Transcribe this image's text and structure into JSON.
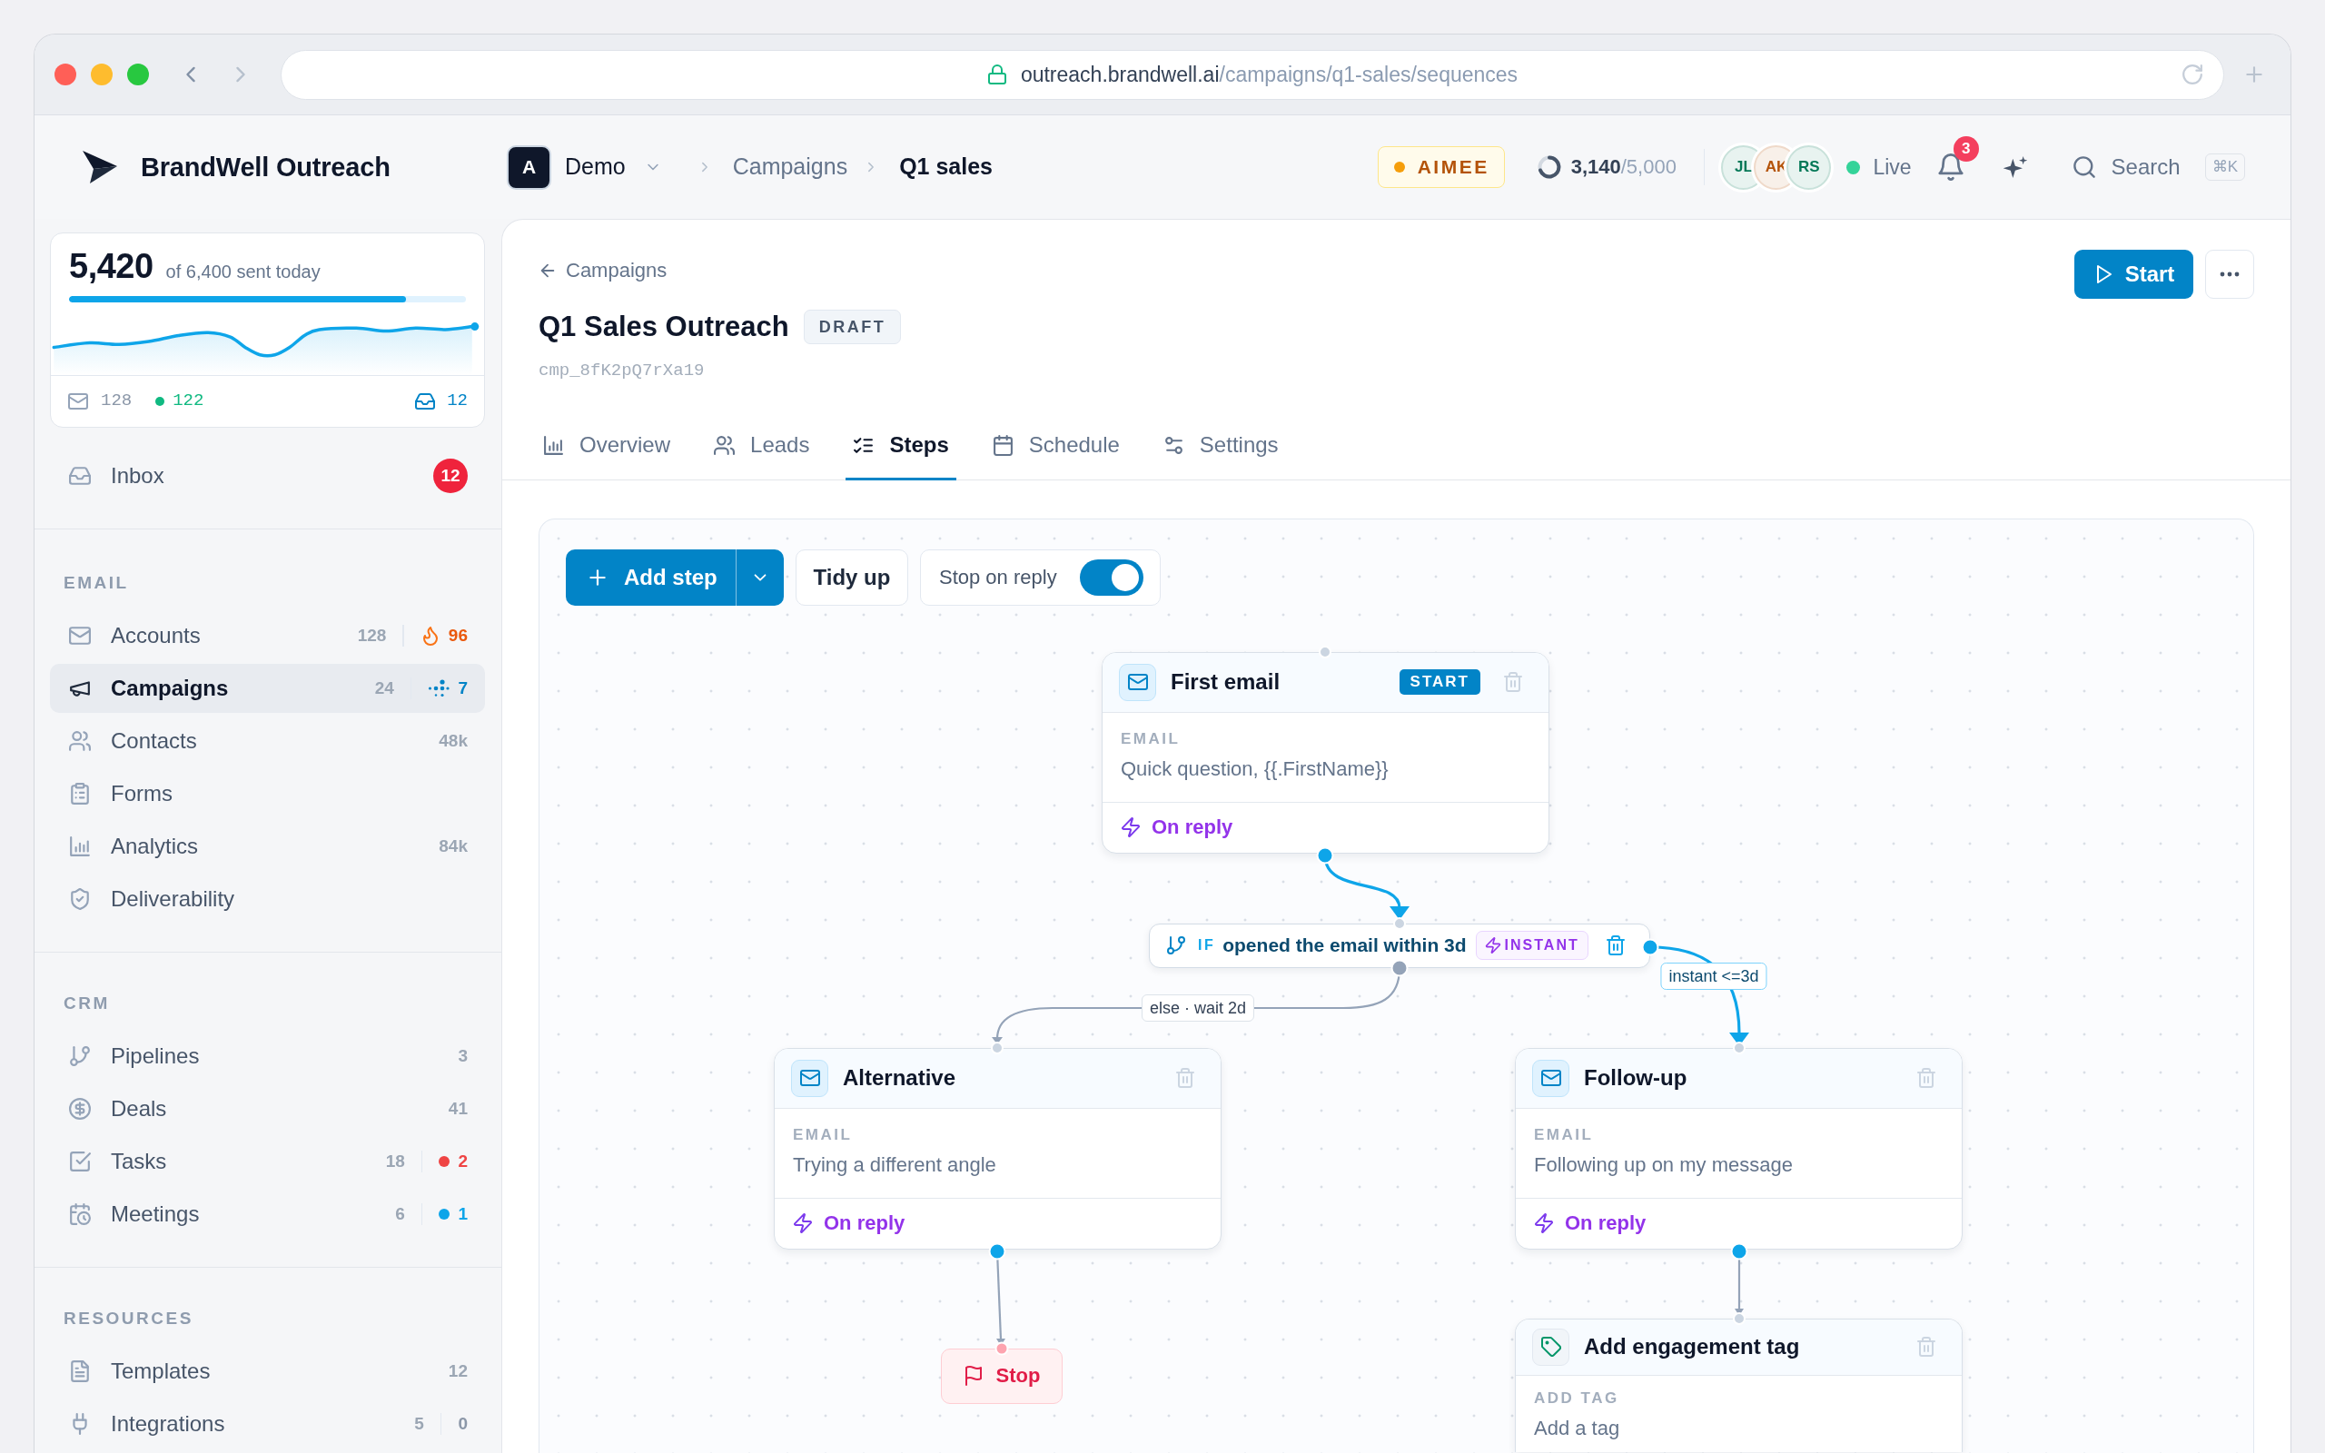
{
  "browser": {
    "url": {
      "host": "outreach.brandwell.ai",
      "path": "/campaigns/q1-sales/sequences"
    }
  },
  "header": {
    "brand": "BrandWell Outreach",
    "workspace": {
      "initial": "A",
      "name": "Demo"
    },
    "breadcrumbs": [
      "Campaigns",
      "Q1 sales"
    ],
    "assistant": "AIMEE",
    "usage": {
      "used": "3,140",
      "limit": "/5,000"
    },
    "members": [
      {
        "initials": "JL",
        "color": "#047857"
      },
      {
        "initials": "AK",
        "color": "#b45309"
      },
      {
        "initials": "RS",
        "color": "#047857"
      }
    ],
    "presence": "Live",
    "notifications": "3",
    "search": {
      "label": "Search",
      "shortcut": "⌘K"
    }
  },
  "sidebar": {
    "stats": {
      "sent": "5,420",
      "caption": "of 6,400 sent today",
      "level": 0.85,
      "emails": "128",
      "delivered": "122",
      "replies": "12"
    },
    "inbox": {
      "label": "Inbox",
      "badge": "12",
      "selected": false
    },
    "sections": [
      {
        "title": "EMAIL",
        "items": [
          {
            "label": "Accounts",
            "count": "128",
            "extra": {
              "kind": "fire",
              "value": "96"
            },
            "selected": false
          },
          {
            "label": "Campaigns",
            "count": "24",
            "extra": {
              "kind": "activity",
              "value": "7"
            },
            "selected": true
          },
          {
            "label": "Contacts",
            "count": "48k",
            "selected": false
          },
          {
            "label": "Forms",
            "selected": false
          },
          {
            "label": "Analytics",
            "count": "84k",
            "selected": false
          },
          {
            "label": "Deliverability",
            "selected": false
          }
        ]
      },
      {
        "title": "CRM",
        "items": [
          {
            "label": "Pipelines",
            "count": "3",
            "selected": false
          },
          {
            "label": "Deals",
            "count": "41",
            "selected": false
          },
          {
            "label": "Tasks",
            "count": "18",
            "extra": {
              "kind": "dot",
              "value": "2",
              "color": "#ef4444"
            },
            "selected": false
          },
          {
            "label": "Meetings",
            "count": "6",
            "extra": {
              "kind": "dot",
              "value": "1",
              "color": "#0ea5e9"
            },
            "selected": false
          }
        ]
      },
      {
        "title": "RESOURCES",
        "items": [
          {
            "label": "Templates",
            "count": "12",
            "selected": false
          },
          {
            "label": "Integrations",
            "count": "5",
            "extra": {
              "kind": "plain",
              "value": "0"
            },
            "selected": false
          }
        ]
      }
    ]
  },
  "campaign": {
    "back": "Campaigns",
    "title": "Q1 Sales Outreach",
    "status": "DRAFT",
    "id": "cmp_8fK2pQ7rXa19",
    "start": "Start"
  },
  "tabs": [
    {
      "label": "Overview",
      "selected": false
    },
    {
      "label": "Leads",
      "selected": false
    },
    {
      "label": "Steps",
      "selected": true
    },
    {
      "label": "Schedule",
      "selected": false
    },
    {
      "label": "Settings",
      "selected": false
    }
  ],
  "canvas": {
    "toolbar": {
      "add_step": "Add step",
      "tidy": "Tidy up",
      "stop_on_reply": {
        "label": "Stop on reply",
        "on": true
      }
    },
    "nodes": [
      {
        "kind": "email",
        "title": "First email",
        "badge": "START",
        "field": "EMAIL",
        "text": "Quick question, {{.FirstName}}",
        "trigger": "On reply"
      },
      {
        "kind": "condition",
        "prefix": "IF",
        "text": "opened the email within 3d",
        "badge": "INSTANT",
        "else_label": "else · wait 2d",
        "then_label": "instant <=3d"
      },
      {
        "kind": "email",
        "title": "Alternative",
        "field": "EMAIL",
        "text": "Trying a different angle",
        "trigger": "On reply"
      },
      {
        "kind": "email",
        "title": "Follow-up",
        "field": "EMAIL",
        "text": "Following up on my message",
        "trigger": "On reply"
      },
      {
        "kind": "stop",
        "title": "Stop"
      },
      {
        "kind": "tag",
        "title": "Add engagement tag",
        "field": "ADD TAG",
        "text": "Add a tag"
      }
    ]
  }
}
